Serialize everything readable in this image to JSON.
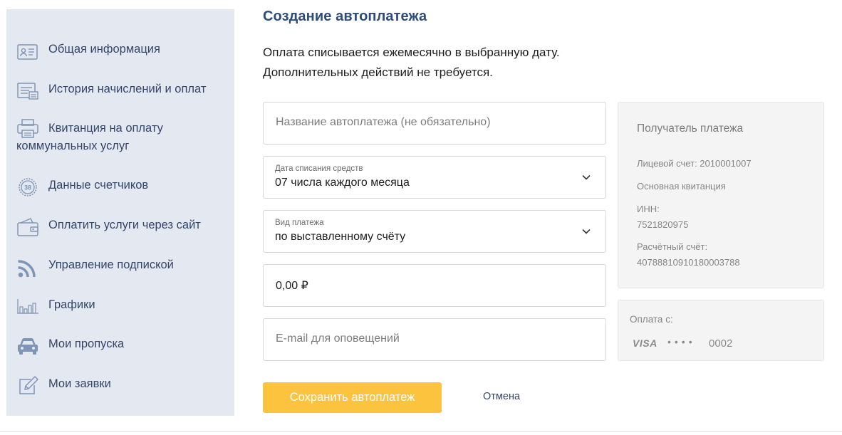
{
  "sidebar": {
    "items": [
      {
        "label": "Общая информация",
        "icon": "id-card-icon"
      },
      {
        "label": "История начислений и оплат",
        "icon": "history-icon"
      },
      {
        "label": "Квитанция на оплату коммунальных услуг",
        "icon": "printer-icon"
      },
      {
        "label": "Данные счетчиков",
        "icon": "meter-icon"
      },
      {
        "label": "Оплатить услуги через сайт",
        "icon": "wallet-icon"
      },
      {
        "label": "Управление подпиской",
        "icon": "rss-icon"
      },
      {
        "label": "Графики",
        "icon": "bar-chart-icon"
      },
      {
        "label": "Мои пропуска",
        "icon": "car-icon"
      },
      {
        "label": "Мои заявки",
        "icon": "edit-icon"
      }
    ],
    "meter_icon_text": "38"
  },
  "main": {
    "title": "Создание автоплатежа",
    "description_line1": "Оплата списывается ежемесячно в выбранную дату.",
    "description_line2": "Дополнительных действий не требуется."
  },
  "form": {
    "name_placeholder": "Название автоплатежа (не обязательно)",
    "date_label": "Дата списания средств",
    "date_value": "07 числа каждого месяца",
    "type_label": "Вид платежа",
    "type_value": "по выставленному счёту",
    "amount_value": "0,00 ₽",
    "email_placeholder": "E-mail для оповещений",
    "save_label": "Сохранить автоплатеж",
    "cancel_label": "Отмена"
  },
  "recipient": {
    "title": "Получатель платежа",
    "account": "Лицевой счет: 2010001007",
    "receipt": "Основная квитанция",
    "inn_label": "ИНН:",
    "inn_value": "7521820975",
    "settlement_label": "Расчётный счёт:",
    "settlement_value": "40788810910180003788"
  },
  "payment_source": {
    "label": "Оплата с:",
    "brand": "VISA",
    "masked": "••••",
    "last4": "0002"
  },
  "colors": {
    "sidebar_bg": "#e4e9f1",
    "nav_text": "#34456a",
    "icon": "#7f95b5",
    "title": "#2c4c7c",
    "button": "#fcc33e",
    "card_bg": "#f4f4f4"
  }
}
